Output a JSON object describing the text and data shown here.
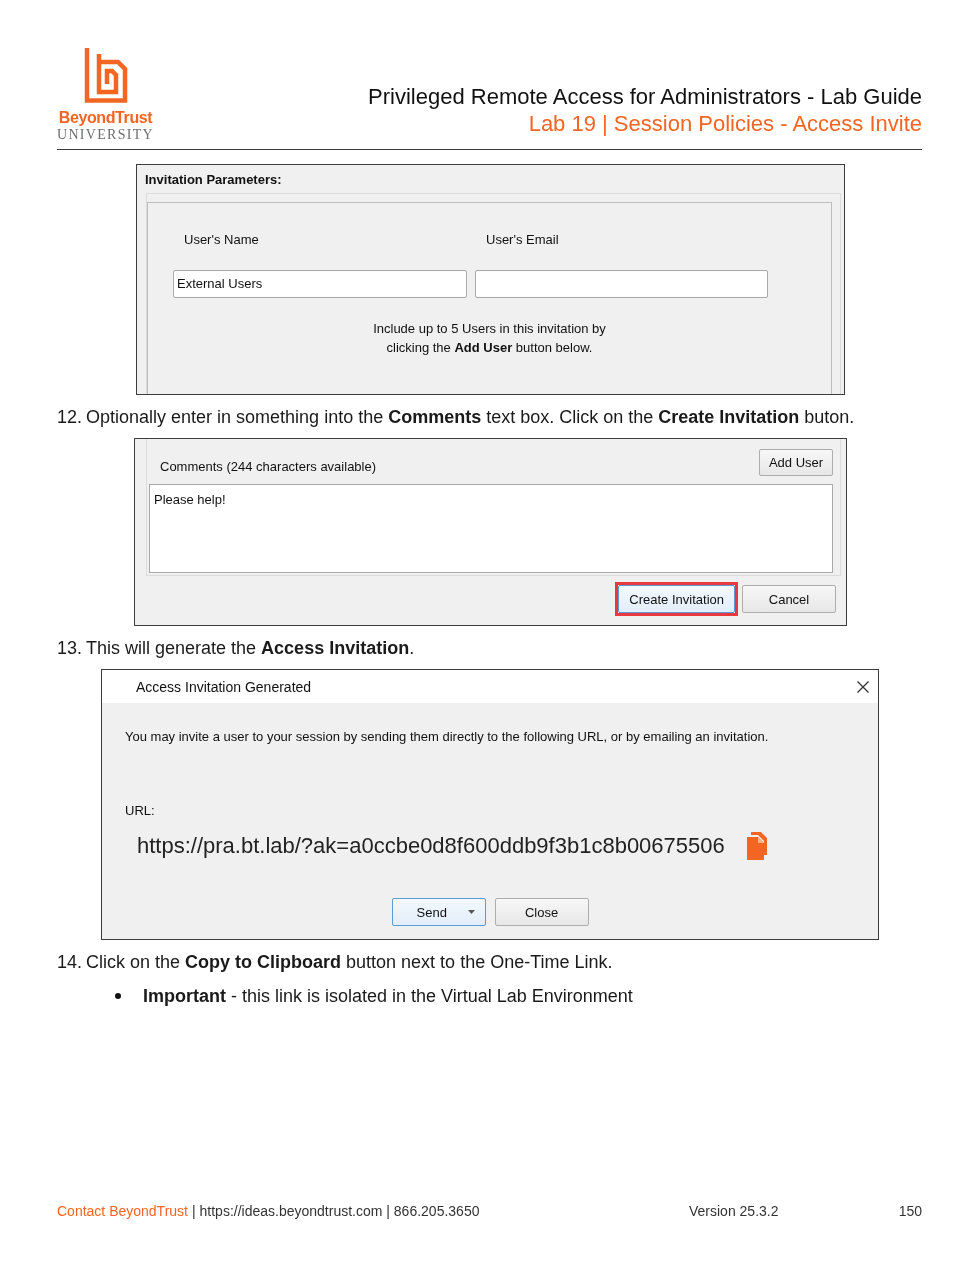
{
  "header": {
    "brand": "BeyondTrust",
    "brand_subtitle": "UNIVERSITY",
    "title": "Privileged Remote Access for Administrators - Lab Guide",
    "subtitle": "Lab 19 | Session Policies - Access Invite"
  },
  "content": [
    {
      "kind": "parameters_panel",
      "title": "Invitation Parameters:",
      "fields": [
        {
          "label": "User's Name",
          "value": "External Users"
        },
        {
          "label": "User's Email"
        }
      ],
      "hint_lines": [
        "Include up to 5 Users in this invitation by",
        "clicking the **Add User** button below."
      ]
    },
    {
      "kind": "step",
      "number": "12.",
      "text": "Optionally enter in something into the **Comments** text box. Click on the **Create Invitation** buton."
    },
    {
      "kind": "comments_panel",
      "label": "Comments (244 characters available)",
      "add_button": {
        "label": "Add User",
        "focused": false
      },
      "comment": "Please help!",
      "buttons": [
        {
          "label": "Create Invitation",
          "focused": true,
          "highlighted": true
        },
        {
          "label": "Cancel",
          "focused": false,
          "highlighted": false
        }
      ]
    },
    {
      "kind": "step",
      "number": "13.",
      "text": "This will generate the **Access Invitation**."
    },
    {
      "kind": "invitation_dialog",
      "title": "Access Invitation Generated",
      "message": "You may invite a user to your session by sending them directly to the following URL, or by emailing an invitation.",
      "url_label": "URL:",
      "url": "https://pra.bt.lab/?ak=a0ccbe0d8f600ddb9f3b1c8b00675506",
      "buttons": [
        {
          "label": "Send",
          "focused": true,
          "dropdown": true
        },
        {
          "label": "Close",
          "focused": false,
          "dropdown": false
        }
      ]
    },
    {
      "kind": "step",
      "number": "14.",
      "text": "Click on the **Copy to Clipboard** button next to the One-Time Link."
    },
    {
      "kind": "bullet",
      "text": "**Important** - this link is isolated in the Virtual Lab Environment"
    }
  ],
  "footer": {
    "contact": "Contact BeyondTrust",
    "details": "| https://ideas.beyondtrust.com | 866.205.3650",
    "version": "Version 25.3.2",
    "page": "150"
  }
}
